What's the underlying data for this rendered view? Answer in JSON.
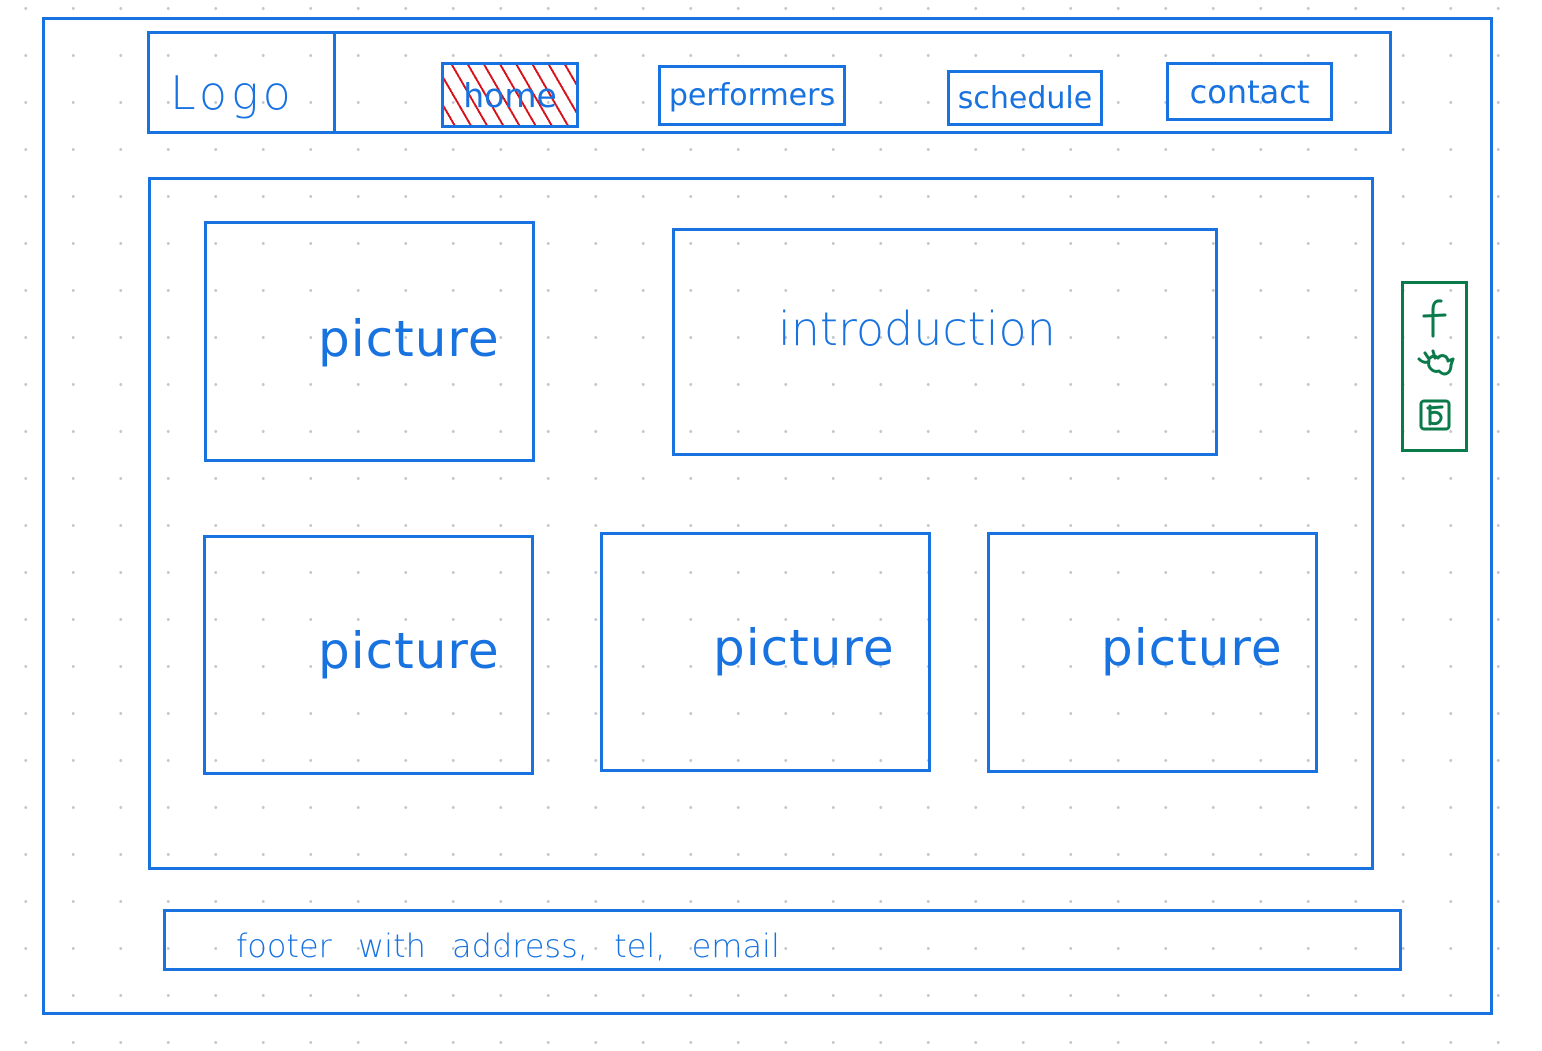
{
  "header": {
    "logo_text": "Logo",
    "nav": [
      {
        "label": "home",
        "active": true
      },
      {
        "label": "performers",
        "active": false
      },
      {
        "label": "schedule",
        "active": false
      },
      {
        "label": "contact",
        "active": false
      }
    ]
  },
  "main": {
    "top_picture_label": "picture",
    "introduction_label": "introduction",
    "bottom_pictures": [
      "picture",
      "picture",
      "picture"
    ]
  },
  "social_icons": [
    "facebook-icon",
    "twitter-icon",
    "wechat-icon"
  ],
  "footer": {
    "text": "footer with address, tel, email"
  },
  "colors": {
    "sketch_blue": "#1873e0",
    "social_green": "#0b7a4a",
    "active_hatch_red": "#d8121b"
  }
}
